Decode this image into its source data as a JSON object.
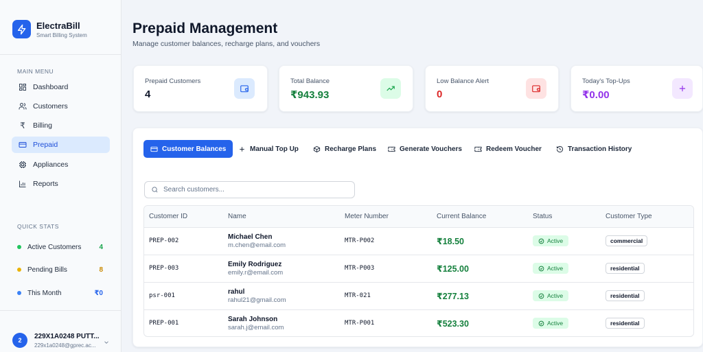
{
  "brand": {
    "title": "ElectraBill",
    "subtitle": "Smart Billing System"
  },
  "sidebar": {
    "main_menu_heading": "MAIN MENU",
    "items": [
      {
        "label": "Dashboard",
        "icon": "grid-icon",
        "active": false
      },
      {
        "label": "Customers",
        "icon": "users-icon",
        "active": false
      },
      {
        "label": "Billing",
        "icon": "rupee-icon",
        "active": false
      },
      {
        "label": "Prepaid",
        "icon": "credit-card-icon",
        "active": true
      },
      {
        "label": "Appliances",
        "icon": "cpu-icon",
        "active": false
      },
      {
        "label": "Reports",
        "icon": "bar-chart-icon",
        "active": false
      }
    ],
    "quick_stats_heading": "QUICK STATS",
    "quick_stats": [
      {
        "label": "Active Customers",
        "value": "4",
        "color": "#22c55e"
      },
      {
        "label": "Pending Bills",
        "value": "8",
        "color": "#eab308"
      },
      {
        "label": "This Month",
        "value": "₹0",
        "color": "#3b82f6"
      }
    ],
    "user": {
      "initial": "2",
      "name": "229X1A0248 PUTT...",
      "email": "229x1a0248@gprec.ac..."
    }
  },
  "header": {
    "title": "Prepaid Management",
    "subtitle": "Manage customer balances, recharge plans, and vouchers"
  },
  "stat_cards": [
    {
      "label": "Prepaid Customers",
      "value": "4",
      "value_color": "#0f172a",
      "icon": "wallet-icon",
      "icon_color": "#2563eb",
      "icon_bg": "#dbeafe"
    },
    {
      "label": "Total Balance",
      "value": "₹943.93",
      "value_color": "#15803d",
      "icon": "trending-up-icon",
      "icon_color": "#16a34a",
      "icon_bg": "#dcfce7"
    },
    {
      "label": "Low Balance Alert",
      "value": "0",
      "value_color": "#dc2626",
      "icon": "wallet-icon",
      "icon_color": "#dc2626",
      "icon_bg": "#fee2e2"
    },
    {
      "label": "Today's Top-Ups",
      "value": "₹0.00",
      "value_color": "#9333ea",
      "icon": "plus-icon",
      "icon_color": "#9333ea",
      "icon_bg": "#f3e8ff"
    }
  ],
  "tabs": [
    {
      "label": "Customer Balances",
      "icon": "credit-card-icon",
      "active": true
    },
    {
      "label": "Manual Top Up",
      "icon": "plus-icon",
      "active": false
    },
    {
      "label": "Recharge Plans",
      "icon": "package-icon",
      "active": false
    },
    {
      "label": "Generate Vouchers",
      "icon": "ticket-icon",
      "active": false
    },
    {
      "label": "Redeem Voucher",
      "icon": "ticket-icon",
      "active": false
    },
    {
      "label": "Transaction History",
      "icon": "history-icon",
      "active": false
    }
  ],
  "search": {
    "placeholder": "Search customers...",
    "value": ""
  },
  "table": {
    "columns": [
      "Customer ID",
      "Name",
      "Meter Number",
      "Current Balance",
      "Status",
      "Customer Type"
    ],
    "rows": [
      {
        "id": "PREP-002",
        "name": "Michael Chen",
        "email": "m.chen@email.com",
        "meter": "MTR-P002",
        "balance": "₹18.50",
        "status": "Active",
        "type": "commercial"
      },
      {
        "id": "PREP-003",
        "name": "Emily Rodriguez",
        "email": "emily.r@email.com",
        "meter": "MTR-P003",
        "balance": "₹125.00",
        "status": "Active",
        "type": "residential"
      },
      {
        "id": "psr-001",
        "name": "rahul",
        "email": "rahul21@gmail.com",
        "meter": "MTR-021",
        "balance": "₹277.13",
        "status": "Active",
        "type": "residential"
      },
      {
        "id": "PREP-001",
        "name": "Sarah Johnson",
        "email": "sarah.j@email.com",
        "meter": "MTR-P001",
        "balance": "₹523.30",
        "status": "Active",
        "type": "residential"
      }
    ]
  }
}
